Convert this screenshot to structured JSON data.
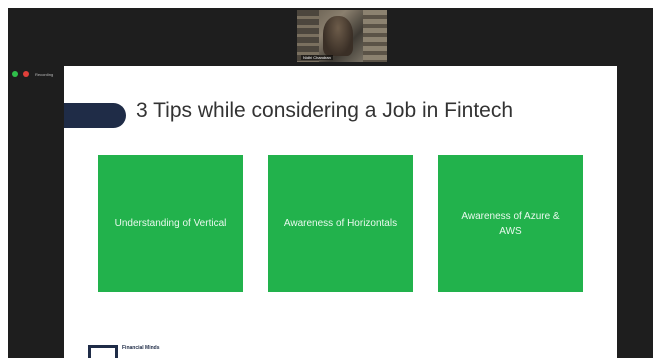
{
  "meeting": {
    "participant_name": "Nidhi Chandran",
    "recording_label": "Recording"
  },
  "slide": {
    "title": "3 Tips while considering a Job in Fintech",
    "tips": [
      {
        "label": "Understanding of Vertical"
      },
      {
        "label": "Awareness of Horizontals"
      },
      {
        "label": "Awareness of Azure & AWS"
      }
    ],
    "logo_text": "Financial Minds"
  },
  "colors": {
    "card_green": "#22b24c",
    "navy": "#1f2c47",
    "title_text": "#333333",
    "status_green": "#2fbf4a",
    "status_red": "#e0403a"
  }
}
